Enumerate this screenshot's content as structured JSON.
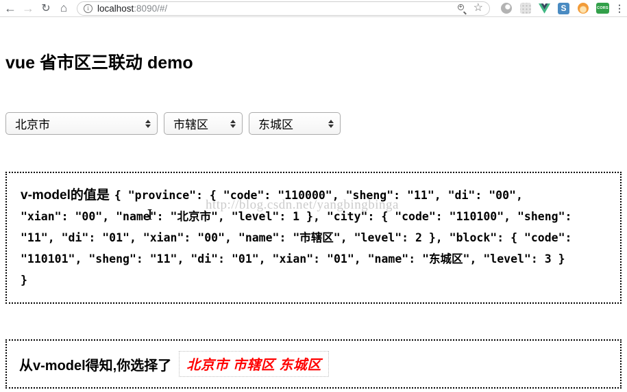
{
  "browser": {
    "url": {
      "host": "localhost",
      "rest": ":8090/#/"
    },
    "info_glyph": "i",
    "back_glyph": "←",
    "forward_glyph": "→",
    "reload_glyph": "↻",
    "home_glyph": "⌂",
    "mag_glyph": "+",
    "star_glyph": "☆",
    "menu_glyph": "⋮",
    "ext_s_label": "S",
    "ext_cors_label": "CORS"
  },
  "page": {
    "title": "vue 省市区三联动 demo",
    "selects": [
      {
        "value": "北京市"
      },
      {
        "value": "市辖区"
      },
      {
        "value": "东城区"
      }
    ],
    "vmodel": {
      "label": "v-model的值是",
      "line1": "{ \"province\": { \"code\": \"110000\", \"sheng\": \"11\", \"di\": \"00\",",
      "line2": "\"xian\": \"00\", \"name\": \"北京市\", \"level\": 1 }, \"city\": { \"code\": \"110100\", \"sheng\":",
      "line3": "\"11\", \"di\": \"01\", \"xian\": \"00\", \"name\": \"市辖区\", \"level\": 2 }, \"block\": { \"code\":",
      "line4": "\"110101\", \"sheng\": \"11\", \"di\": \"01\", \"xian\": \"01\", \"name\": \"东城区\", \"level\": 3 }",
      "line5": "}"
    },
    "watermark": "http://blog.csdn.net/yangbingbinga",
    "result": {
      "label": "从v-model得知,你选择了",
      "value": "北京市 市辖区 东城区"
    },
    "colors": {
      "result_red": "#ff0000",
      "vue_green": "#41b883",
      "vue_dark": "#35495e",
      "cors_green": "#33a04a",
      "s_blue": "#4a8bc2",
      "box_border": "#000000"
    }
  }
}
